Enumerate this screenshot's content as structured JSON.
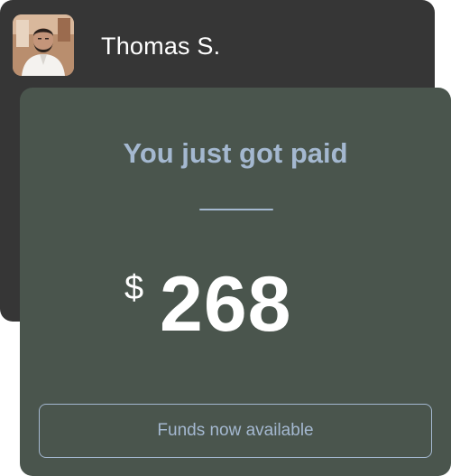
{
  "user": {
    "name": "Thomas S.",
    "avatar_icon": "user-photo-avatar"
  },
  "payment": {
    "title": "You just got paid",
    "currency_symbol": "$",
    "amount": "268",
    "status_button_label": "Funds now available"
  },
  "colors": {
    "user_card_bg": "#363636",
    "payment_card_bg": "#4a554d",
    "accent_blue": "#a4b8d0",
    "text_white": "#ffffff"
  }
}
